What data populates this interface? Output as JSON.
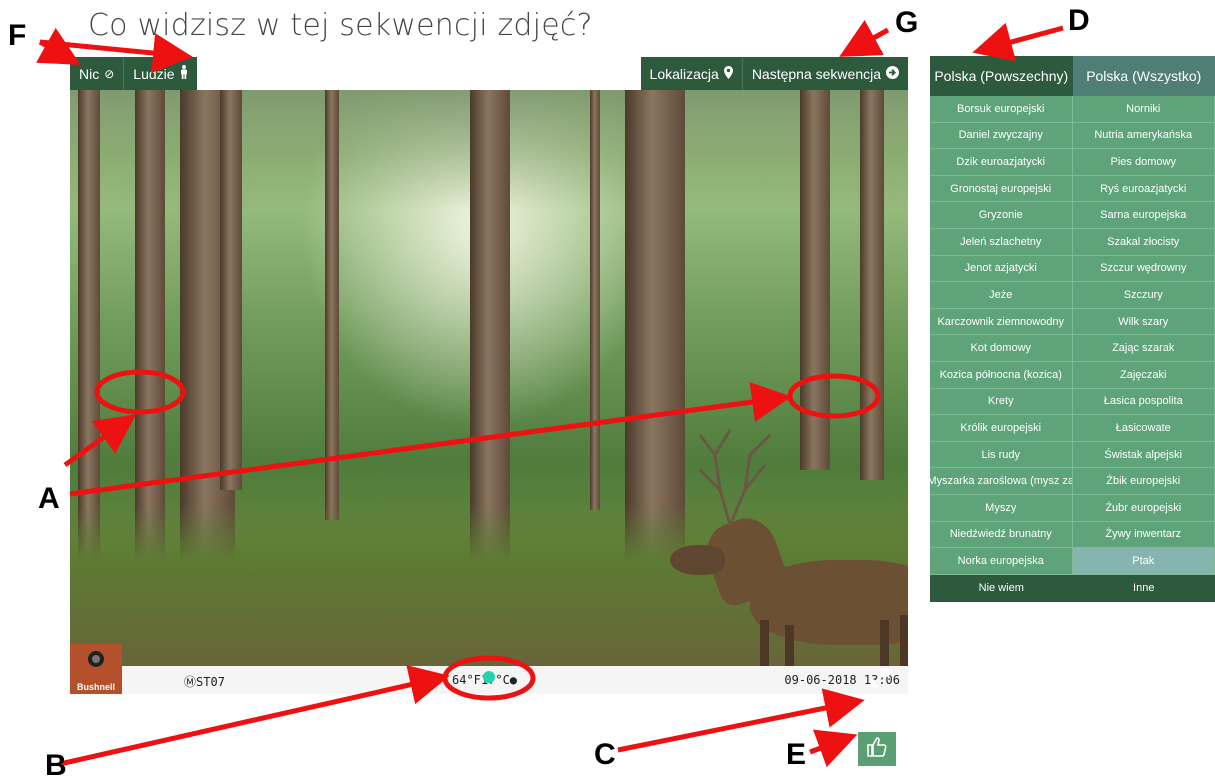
{
  "page": {
    "title": "Co widzisz w tej sekwencji zdjęć?"
  },
  "toolbar_left": [
    {
      "label": "Nic",
      "icon": "ban-icon"
    },
    {
      "label": "Ludzie",
      "icon": "person-icon"
    }
  ],
  "toolbar_right": [
    {
      "label": "Lokalizacja",
      "icon": "map-marker-icon"
    },
    {
      "label": "Następna sekwencja",
      "icon": "arrow-circle-right-icon"
    }
  ],
  "photo": {
    "brand": "Bushnell",
    "camera_id": "ST07",
    "temperature": "64°F17°C",
    "datetime": "09-06-2018 13:06"
  },
  "species_panel": {
    "tabs": [
      "Polska (Powszechny)",
      "Polska (Wszystko)"
    ],
    "active_tab": 0,
    "species": [
      [
        "Borsuk europejski",
        "Norniki"
      ],
      [
        "Daniel zwyczajny",
        "Nutria amerykańska"
      ],
      [
        "Dzik euroazjatycki",
        "Pies domowy"
      ],
      [
        "Gronostaj europejski",
        "Ryś euroazjatycki"
      ],
      [
        "Gryzonie",
        "Sarna europejska"
      ],
      [
        "Jeleń szlachetny",
        "Szakal złocisty"
      ],
      [
        "Jenot azjatycki",
        "Szczur wędrowny"
      ],
      [
        "Jeże",
        "Szczury"
      ],
      [
        "Karczownik ziemnowodny",
        "Wilk szary"
      ],
      [
        "Kot domowy",
        "Zając szarak"
      ],
      [
        "Kozica północna (kozica)",
        "Zajęczaki"
      ],
      [
        "Krety",
        "Łasica pospolita"
      ],
      [
        "Królik europejski",
        "Łasicowate"
      ],
      [
        "Lis rudy",
        "Świstak alpejski"
      ],
      [
        "Myszarka zaroślowa (mysz za",
        "Żbik europejski"
      ],
      [
        "Myszy",
        "Żubr europejski"
      ],
      [
        "Niedźwiedź brunatny",
        "Żywy inwentarz"
      ],
      [
        "Norka europejska",
        "Ptak"
      ]
    ],
    "selected": "Ptak",
    "footer": [
      "Nie wiem",
      "Inne"
    ]
  },
  "annotations": [
    "A",
    "B",
    "C",
    "D",
    "E",
    "F",
    "G"
  ],
  "colors": {
    "dark_green": "#2d5a3d",
    "species_green": "#5ea37a",
    "annotation_red": "#ee1111",
    "dot": "#22d3b0"
  }
}
